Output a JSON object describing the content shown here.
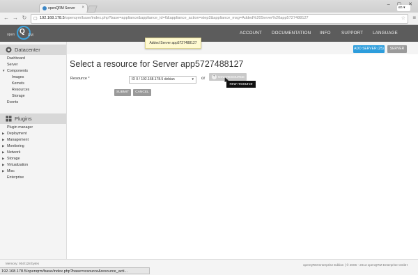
{
  "browser": {
    "tab_title": "openQRM Server",
    "tab_close": "×",
    "url_host": "192.168.178.5",
    "url_path": "/openqrm/base/index.php?base=appliance&appliance_id=6&appliance_action=step2&appliance_msg=Added%20Server%20app5727488127"
  },
  "header": {
    "logo_prefix": "open",
    "logo_q": "Q",
    "logo_suffix": "RM",
    "nav": [
      "ACCOUNT",
      "DOCUMENTATION",
      "INFO",
      "SUPPORT",
      "LANGUAGE"
    ],
    "language_value": "en"
  },
  "toast": {
    "message": "Added Server app5727488127"
  },
  "actions": {
    "add_server": "ADD SERVER (25)",
    "server": "SERVER"
  },
  "sidebar": {
    "datacenter_title": "Datacenter",
    "datacenter_items": [
      {
        "label": "Dashboard"
      },
      {
        "label": "Server"
      },
      {
        "label": "Components"
      },
      {
        "label": "Images"
      },
      {
        "label": "Kernels"
      },
      {
        "label": "Resources"
      },
      {
        "label": "Storage"
      },
      {
        "label": "Events"
      }
    ],
    "plugins_title": "Plugins",
    "plugin_items": [
      {
        "label": "Plugin manager"
      },
      {
        "label": "Deployment"
      },
      {
        "label": "Management"
      },
      {
        "label": "Monitoring"
      },
      {
        "label": "Network"
      },
      {
        "label": "Storage"
      },
      {
        "label": "Virtualization"
      },
      {
        "label": "Misc"
      },
      {
        "label": "Enterprise"
      }
    ]
  },
  "main": {
    "title": "Select a resource for Server app5727488127",
    "resource_label": "Resource *",
    "resource_selected": "ID 0 / 192.168.178.5 debian",
    "or_label": "or",
    "new_resource_label": "NEW RESOURCE",
    "tooltip": "new resource",
    "submit_label": "SUBMIT",
    "cancel_label": "CANCEL"
  },
  "footer": {
    "memory": "Memory: 904/128 bytes",
    "copyright": "openQRM Enterprise Edition | © 2006 - 2013 openQRM Enterprise GmbH",
    "status_url": "192.168.178.5/openqrm/base/index.php?base=resource&resource_acti..."
  },
  "colors": {
    "accent": "#2d9ddc",
    "header": "#5c5c5c",
    "toast": "#fffad1"
  }
}
